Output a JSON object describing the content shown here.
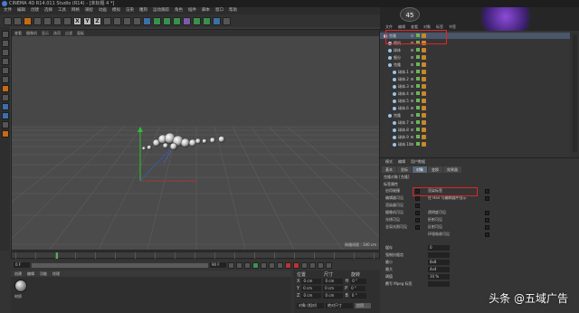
{
  "window": {
    "title": "CINEMA 4D R14.011 Studio (R14) - [未标题 4 *]"
  },
  "menubar": {
    "items": [
      "文件",
      "编辑",
      "创建",
      "选择",
      "工具",
      "网格",
      "捕捉",
      "动画",
      "模拟",
      "渲染",
      "雕刻",
      "运动跟踪",
      "角色",
      "插件",
      "脚本",
      "窗口",
      "帮助"
    ]
  },
  "toolbar": {
    "x_label": "X",
    "y_label": "Y",
    "z_label": "Z"
  },
  "viewport": {
    "menu": [
      "查看",
      "摄像机",
      "显示",
      "选项",
      "过滤",
      "面板"
    ],
    "label": "透视视图",
    "info": "网格间距 : 100 cm"
  },
  "timeline": {
    "start": "0 F",
    "end": "90 F",
    "current": "90 F",
    "frame_field": "0 F",
    "max_field": "90 F"
  },
  "material": {
    "menu": [
      "创建",
      "编辑",
      "功能",
      "纹理"
    ],
    "name": "材质"
  },
  "coords": {
    "headers": [
      "位置",
      "尺寸",
      "旋转"
    ],
    "rows": [
      {
        "axis": "X",
        "pos": "0 cm",
        "size": "0 cm",
        "rot_axis": "H",
        "rot": "0 °"
      },
      {
        "axis": "Y",
        "pos": "0 cm",
        "size": "0 cm",
        "rot_axis": "P",
        "rot": "0 °"
      },
      {
        "axis": "Z",
        "pos": "0 cm",
        "size": "0 cm",
        "rot_axis": "B",
        "rot": "0 °"
      }
    ],
    "mode": "对象 (相对)",
    "size_mode": "绝对尺寸",
    "apply": "应用"
  },
  "right": {
    "badge": "45",
    "objmenu": [
      "文件",
      "编辑",
      "查看",
      "对象",
      "标签",
      "书签"
    ],
    "objects": [
      {
        "name": "克隆",
        "indent": 0
      },
      {
        "name": "随机",
        "indent": 1
      },
      {
        "name": "球体",
        "indent": 1
      },
      {
        "name": "细分",
        "indent": 1
      },
      {
        "name": "克隆",
        "indent": 1
      },
      {
        "name": "球体.1",
        "indent": 2
      },
      {
        "name": "球体.2",
        "indent": 2
      },
      {
        "name": "球体.3",
        "indent": 2
      },
      {
        "name": "球体.4",
        "indent": 2
      },
      {
        "name": "球体.5",
        "indent": 2
      },
      {
        "name": "球体.6",
        "indent": 2
      },
      {
        "name": "克隆",
        "indent": 1
      },
      {
        "name": "球体.7",
        "indent": 2
      },
      {
        "name": "球体.8",
        "indent": 2
      },
      {
        "name": "球体.9",
        "indent": 2
      },
      {
        "name": "球体.10",
        "indent": 2
      }
    ],
    "attr": {
      "menu": [
        "模式",
        "编辑",
        "用户数据"
      ],
      "title": "克隆对象 [克隆]",
      "tabs": [
        "基本",
        "坐标",
        "对象",
        "变换",
        "效果器"
      ],
      "section": "标签属性",
      "rows": [
        {
          "left": "启用碰撞",
          "right": "渲染标签"
        },
        {
          "left": "编辑器可见",
          "right": "在 Hair 与编辑器中显示"
        },
        {
          "left": "渲染器可见",
          "right": ""
        },
        {
          "left": "摄像机可见",
          "right": "透明度可见"
        },
        {
          "left": "光线可见",
          "right": "折射可见"
        },
        {
          "left": "全局光照可见",
          "right": "反射可见"
        },
        {
          "left": "",
          "right": "环境吸收可见"
        }
      ],
      "more": [
        {
          "label": "缓存",
          "value": "0"
        },
        {
          "label": "强制抗锯齿",
          "value": ""
        },
        {
          "label": "最小",
          "value": "8x8"
        },
        {
          "label": "最大",
          "value": "4x4"
        },
        {
          "label": "阈值",
          "value": "10 %"
        },
        {
          "label": "覆写 Mpeg 标签",
          "value": ""
        }
      ]
    }
  },
  "watermark": "头条 @五域广告"
}
